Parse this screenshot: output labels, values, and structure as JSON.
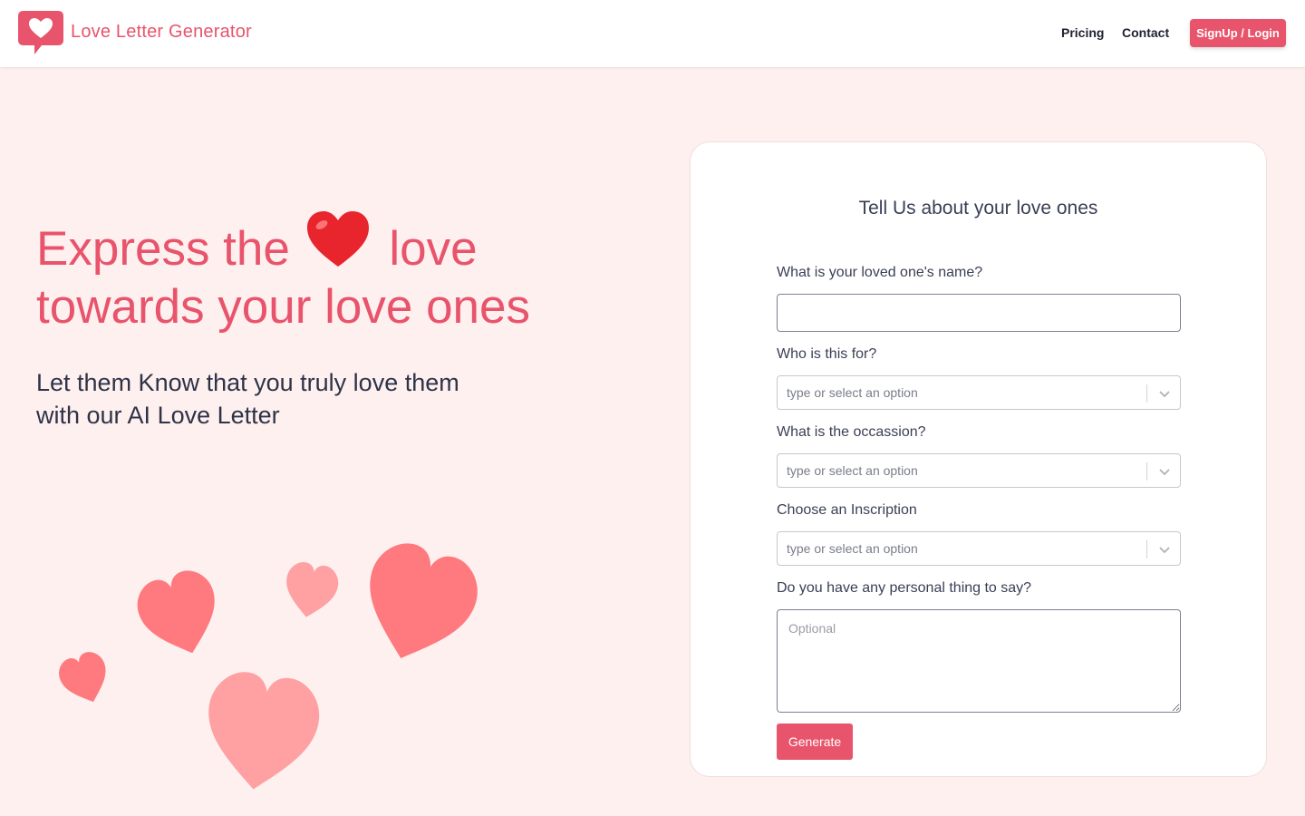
{
  "header": {
    "brand": "Love Letter Generator",
    "nav": {
      "pricing": "Pricing",
      "contact": "Contact"
    },
    "signup_label": "SignUp / Login"
  },
  "hero": {
    "headline_part1": "Express the",
    "headline_emoji": "❤️",
    "headline_part2": "love",
    "headline_line2": "towards your love ones",
    "subline_1": "Let them Know that you truly love them",
    "subline_2": "with our AI Love Letter"
  },
  "form": {
    "title": "Tell Us about your love ones",
    "name_label": "What is your loved one's name?",
    "name_value": "",
    "recipient_label": "Who is this for?",
    "recipient_placeholder": "type or select an option",
    "occasion_label": "What is the occassion?",
    "occasion_placeholder": "type or select an option",
    "inscription_label": "Choose an Inscription",
    "inscription_placeholder": "type or select an option",
    "personal_label": "Do you have any personal thing to say?",
    "personal_placeholder": "Optional",
    "generate_label": "Generate"
  },
  "colors": {
    "accent": "#e8546b",
    "background": "#fff0f0",
    "heart_dark": "#ff7a7f",
    "heart_light": "#ffa0a3"
  }
}
